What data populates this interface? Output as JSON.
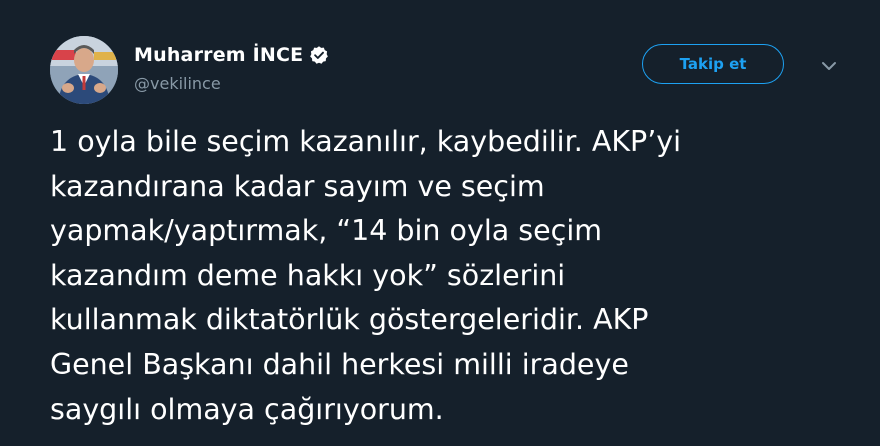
{
  "user": {
    "display_name": "Muharrem İNCE",
    "handle": "@vekilince",
    "verified": true
  },
  "follow_button": {
    "label": "Takip et"
  },
  "icons": {
    "verified": "verified-badge-icon",
    "menu": "chevron-down-icon"
  },
  "tweet": {
    "lines": [
      "1 oyla bile seçim kazanılır, kaybedilir. AKP’yi",
      "kazandırana kadar sayım ve seçim",
      "yapmak/yaptırmak, “14 bin oyla seçim",
      "kazandım deme hakkı yok” sözlerini",
      "kullanmak diktatörlük göstergeleridir. AKP",
      "Genel Başkanı dahil herkesi milli iradeye",
      "saygılı olmaya çağırıyorum."
    ]
  },
  "colors": {
    "background": "#15202b",
    "text_primary": "#ffffff",
    "text_secondary": "#8899a6",
    "accent": "#1da1f2"
  }
}
